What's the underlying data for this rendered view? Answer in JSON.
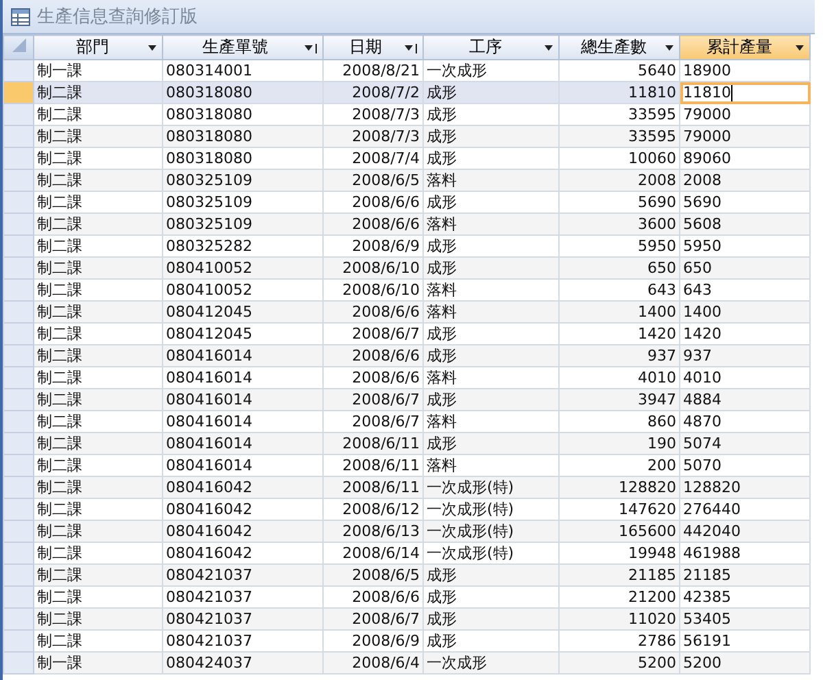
{
  "window": {
    "title": "生產信息查詢修訂版"
  },
  "columns": [
    {
      "label": "部門",
      "sorted": false,
      "selected": false,
      "kind": "text"
    },
    {
      "label": "生產單號",
      "sorted": true,
      "selected": false,
      "kind": "text"
    },
    {
      "label": "日期",
      "sorted": true,
      "selected": false,
      "kind": "date"
    },
    {
      "label": "工序",
      "sorted": false,
      "selected": false,
      "kind": "text"
    },
    {
      "label": "總生產數",
      "sorted": false,
      "selected": false,
      "kind": "number"
    },
    {
      "label": "累計產量",
      "sorted": false,
      "selected": true,
      "kind": "text"
    }
  ],
  "rows": [
    {
      "selected": false,
      "cells": [
        "制一課",
        "080314001",
        "2008/8/21",
        "一次成形",
        "5640",
        "18900"
      ]
    },
    {
      "selected": true,
      "cells": [
        "制二課",
        "080318080",
        "2008/7/2",
        "成形",
        "11810",
        "11810"
      ]
    },
    {
      "selected": false,
      "cells": [
        "制二課",
        "080318080",
        "2008/7/3",
        "成形",
        "33595",
        "79000"
      ]
    },
    {
      "selected": false,
      "cells": [
        "制二課",
        "080318080",
        "2008/7/3",
        "成形",
        "33595",
        "79000"
      ]
    },
    {
      "selected": false,
      "cells": [
        "制二課",
        "080318080",
        "2008/7/4",
        "成形",
        "10060",
        "89060"
      ]
    },
    {
      "selected": false,
      "cells": [
        "制二課",
        "080325109",
        "2008/6/5",
        "落料",
        "2008",
        "2008"
      ]
    },
    {
      "selected": false,
      "cells": [
        "制二課",
        "080325109",
        "2008/6/6",
        "成形",
        "5690",
        "5690"
      ]
    },
    {
      "selected": false,
      "cells": [
        "制二課",
        "080325109",
        "2008/6/6",
        "落料",
        "3600",
        "5608"
      ]
    },
    {
      "selected": false,
      "cells": [
        "制二課",
        "080325282",
        "2008/6/9",
        "成形",
        "5950",
        "5950"
      ]
    },
    {
      "selected": false,
      "cells": [
        "制二課",
        "080410052",
        "2008/6/10",
        "成形",
        "650",
        "650"
      ]
    },
    {
      "selected": false,
      "cells": [
        "制二課",
        "080410052",
        "2008/6/10",
        "落料",
        "643",
        "643"
      ]
    },
    {
      "selected": false,
      "cells": [
        "制二課",
        "080412045",
        "2008/6/6",
        "落料",
        "1400",
        "1400"
      ]
    },
    {
      "selected": false,
      "cells": [
        "制二課",
        "080412045",
        "2008/6/7",
        "成形",
        "1420",
        "1420"
      ]
    },
    {
      "selected": false,
      "cells": [
        "制二課",
        "080416014",
        "2008/6/6",
        "成形",
        "937",
        "937"
      ]
    },
    {
      "selected": false,
      "cells": [
        "制二課",
        "080416014",
        "2008/6/6",
        "落料",
        "4010",
        "4010"
      ]
    },
    {
      "selected": false,
      "cells": [
        "制二課",
        "080416014",
        "2008/6/7",
        "成形",
        "3947",
        "4884"
      ]
    },
    {
      "selected": false,
      "cells": [
        "制二課",
        "080416014",
        "2008/6/7",
        "落料",
        "860",
        "4870"
      ]
    },
    {
      "selected": false,
      "cells": [
        "制二課",
        "080416014",
        "2008/6/11",
        "成形",
        "190",
        "5074"
      ]
    },
    {
      "selected": false,
      "cells": [
        "制二課",
        "080416014",
        "2008/6/11",
        "落料",
        "200",
        "5070"
      ]
    },
    {
      "selected": false,
      "cells": [
        "制二課",
        "080416042",
        "2008/6/11",
        "一次成形(特)",
        "128820",
        "128820"
      ]
    },
    {
      "selected": false,
      "cells": [
        "制二課",
        "080416042",
        "2008/6/12",
        "一次成形(特)",
        "147620",
        "276440"
      ]
    },
    {
      "selected": false,
      "cells": [
        "制二課",
        "080416042",
        "2008/6/13",
        "一次成形(特)",
        "165600",
        "442040"
      ]
    },
    {
      "selected": false,
      "cells": [
        "制二課",
        "080416042",
        "2008/6/14",
        "一次成形(特)",
        "19948",
        "461988"
      ]
    },
    {
      "selected": false,
      "cells": [
        "制二課",
        "080421037",
        "2008/6/5",
        "成形",
        "21185",
        "21185"
      ]
    },
    {
      "selected": false,
      "cells": [
        "制二課",
        "080421037",
        "2008/6/6",
        "成形",
        "21200",
        "42385"
      ]
    },
    {
      "selected": false,
      "cells": [
        "制二課",
        "080421037",
        "2008/6/7",
        "成形",
        "11020",
        "53405"
      ]
    },
    {
      "selected": false,
      "cells": [
        "制二課",
        "080421037",
        "2008/6/9",
        "成形",
        "2786",
        "56191"
      ]
    },
    {
      "selected": false,
      "cells": [
        "制一課",
        "080424037",
        "2008/6/4",
        "一次成形",
        "5200",
        "5200"
      ]
    }
  ]
}
